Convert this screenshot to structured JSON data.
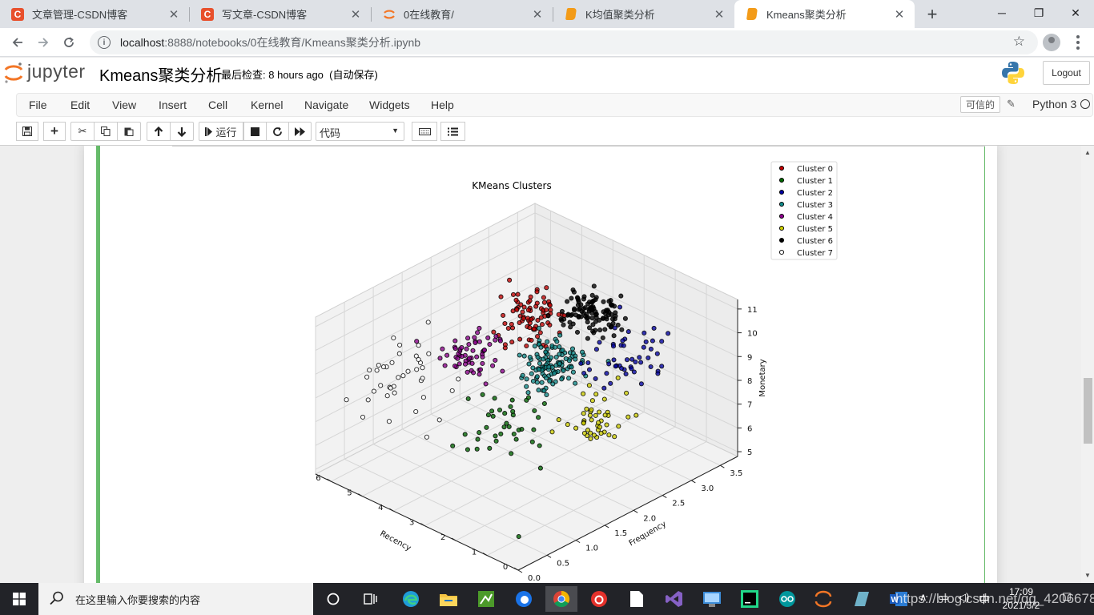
{
  "browser": {
    "tabs": [
      {
        "label": "文章管理-CSDN博客",
        "icon": "csdn-icon"
      },
      {
        "label": "写文章-CSDN博客",
        "icon": "csdn-icon"
      },
      {
        "label": "0在线教育/",
        "icon": "jupyter-icon"
      },
      {
        "label": "K均值聚类分析",
        "icon": "notebook-icon"
      },
      {
        "label": "Kmeans聚类分析",
        "icon": "notebook-icon"
      }
    ],
    "active_tab": 4,
    "url_host": "localhost",
    "url_path": ":8888/notebooks/0在线教育/Kmeans聚类分析.ipynb"
  },
  "jupyter": {
    "logo_text": "jupyter",
    "notebook_title": "Kmeans聚类分析",
    "checkpoint_label": "最后检查:",
    "checkpoint_time": "8 hours ago",
    "autosave": "(自动保存)",
    "logout": "Logout",
    "menu": [
      "File",
      "Edit",
      "View",
      "Insert",
      "Cell",
      "Kernel",
      "Navigate",
      "Widgets",
      "Help"
    ],
    "trusted": "可信的",
    "kernel_name": "Python 3",
    "run_label": "运行",
    "cell_type": "代码"
  },
  "chart_data": {
    "type": "scatter",
    "title": "KMeans Clusters",
    "xlabel": "Recency",
    "ylabel": "Frequency",
    "zlabel": "Monetary",
    "xlim": [
      0,
      6.5
    ],
    "ylim": [
      0,
      3.8
    ],
    "zlim": [
      4.8,
      11.4
    ],
    "xticks": [
      "0",
      "1",
      "2",
      "3",
      "4",
      "5",
      "6"
    ],
    "yticks": [
      "0.0",
      "0.5",
      "1.0",
      "1.5",
      "2.0",
      "2.5",
      "3.0",
      "3.5"
    ],
    "zticks": [
      "5",
      "6",
      "7",
      "8",
      "9",
      "10",
      "11"
    ],
    "legend_position": "top-right",
    "series": [
      {
        "name": "Cluster 0",
        "color": "#c00000",
        "center": [
          4.1,
          2.45,
          9.8
        ],
        "spread": [
          0.5,
          0.28,
          0.65
        ],
        "count": 80
      },
      {
        "name": "Cluster 1",
        "color": "#006400",
        "center": [
          2.6,
          1.15,
          7.7
        ],
        "spread": [
          0.7,
          0.35,
          0.9
        ],
        "count": 40
      },
      {
        "name": "Cluster 2",
        "color": "#0000a0",
        "center": [
          1.8,
          2.95,
          9.0
        ],
        "spread": [
          0.55,
          0.4,
          0.9
        ],
        "count": 50
      },
      {
        "name": "Cluster 3",
        "color": "#108888",
        "center": [
          2.9,
          2.1,
          9.0
        ],
        "spread": [
          0.5,
          0.3,
          0.6
        ],
        "count": 120
      },
      {
        "name": "Cluster 4",
        "color": "#8b008b",
        "center": [
          4.4,
          1.6,
          9.1
        ],
        "spread": [
          0.45,
          0.3,
          0.6
        ],
        "count": 60
      },
      {
        "name": "Cluster 5",
        "color": "#cccc00",
        "center": [
          1.4,
          2.05,
          7.8
        ],
        "spread": [
          0.5,
          0.35,
          0.8
        ],
        "count": 45
      },
      {
        "name": "Cluster 6",
        "color": "#000000",
        "center": [
          3.0,
          2.9,
          10.1
        ],
        "spread": [
          0.5,
          0.25,
          0.45
        ],
        "count": 110
      },
      {
        "name": "Cluster 7",
        "color": "#ffffff",
        "center": [
          5.3,
          0.9,
          8.3
        ],
        "spread": [
          0.7,
          0.45,
          1.1
        ],
        "count": 40
      }
    ]
  },
  "taskbar": {
    "search_placeholder": "在这里输入你要搜索的内容",
    "time": "17:09",
    "date": "2021/3/2",
    "ime": "中",
    "watermark": "https://blog.csdn.net/qq_42066782"
  }
}
